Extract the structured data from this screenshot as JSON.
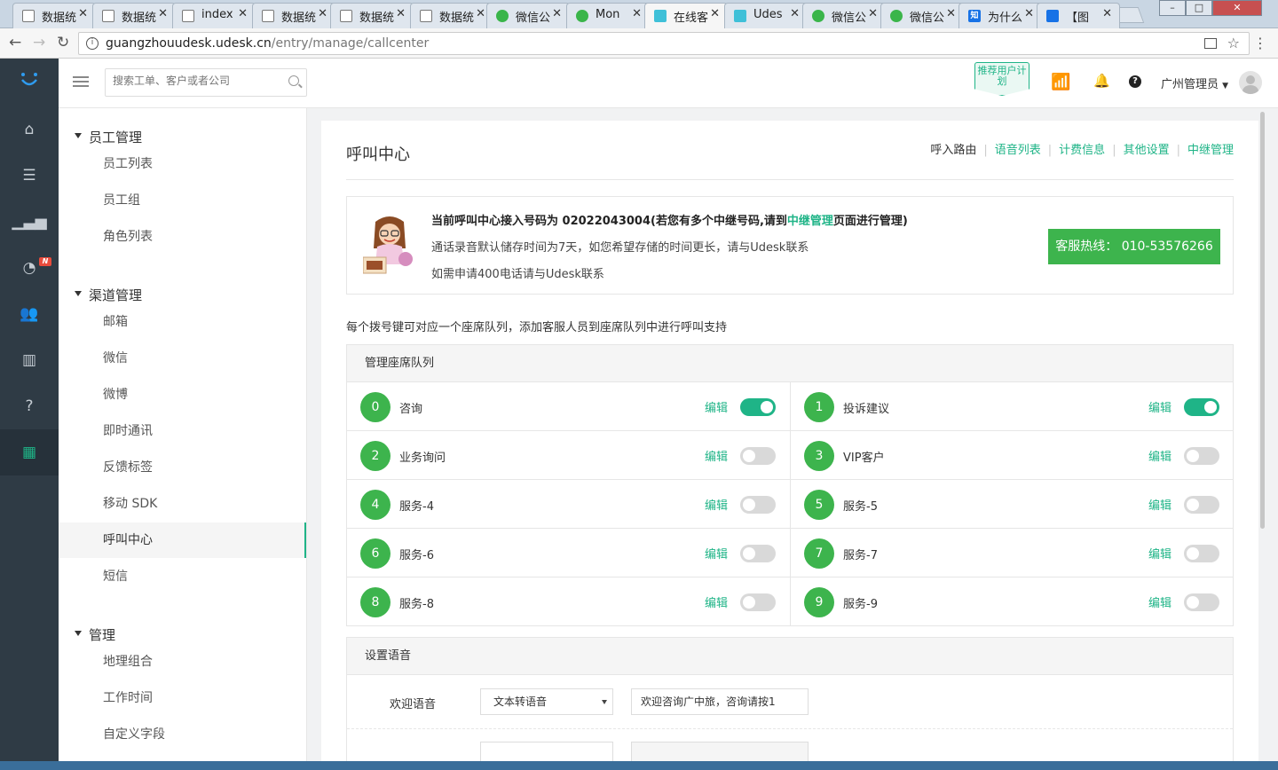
{
  "browser": {
    "tabs": [
      {
        "label": "数据统",
        "icon": "page-icon",
        "active": false
      },
      {
        "label": "数据统",
        "icon": "page-icon",
        "active": false
      },
      {
        "label": "index",
        "icon": "page-icon",
        "active": false
      },
      {
        "label": "数据统",
        "icon": "page-icon",
        "active": false
      },
      {
        "label": "数据统",
        "icon": "page-icon",
        "active": false
      },
      {
        "label": "数据统",
        "icon": "page-icon",
        "active": false
      },
      {
        "label": "微信公",
        "icon": "wechat-icon",
        "active": false
      },
      {
        "label": "Mon",
        "icon": "monitor-icon",
        "active": false
      },
      {
        "label": "在线客",
        "icon": "udesk-icon",
        "active": true
      },
      {
        "label": "Udes",
        "icon": "udesk-icon",
        "active": false
      },
      {
        "label": "微信公",
        "icon": "wechat-icon",
        "active": false
      },
      {
        "label": "微信公",
        "icon": "wechat-icon",
        "active": false
      },
      {
        "label": "为什么",
        "icon": "zhihu-icon",
        "active": false
      },
      {
        "label": "【图",
        "icon": "baidu-icon",
        "active": false
      }
    ],
    "url_host": "guangzhouudesk.udesk.cn",
    "url_path": "/entry/manage/callcenter"
  },
  "topbar": {
    "search_placeholder": "搜索工单、客户或者公司",
    "promo_label": "推荐用户计划",
    "admin_name": "广州管理员"
  },
  "sidebar": {
    "groups": [
      {
        "label": "员工管理",
        "items": [
          "员工列表",
          "员工组",
          "角色列表"
        ]
      },
      {
        "label": "渠道管理",
        "items": [
          "邮箱",
          "微信",
          "微博",
          "即时通讯",
          "反馈标签",
          "移动 SDK",
          "呼叫中心",
          "短信"
        ]
      },
      {
        "label": "管理",
        "items": [
          "地理组合",
          "工作时间",
          "自定义字段"
        ]
      }
    ],
    "active_item": "呼叫中心"
  },
  "page": {
    "title": "呼叫中心",
    "links": [
      "呼入路由",
      "语音列表",
      "计费信息",
      "其他设置",
      "中继管理"
    ],
    "info": {
      "line1_prefix": "当前呼叫中心接入号码为 02022043004(若您有多个中继号码,请到",
      "line1_link": "中继管理",
      "line1_suffix": "页面进行管理)",
      "line2": "通话录音默认储存时间为7天，如您希望存储的时间更长，请与Udesk联系",
      "line3": "如需申请400电话请与Udesk联系",
      "hotline": "客服热线： 010-53576266"
    },
    "note": "每个拨号键可对应一个座席队列，添加客服人员到座席队列中进行呼叫支持",
    "queue_title": "管理座席队列",
    "edit_label": "编辑",
    "queues": [
      {
        "key": "0",
        "name": "咨询",
        "enabled": true
      },
      {
        "key": "1",
        "name": "投诉建议",
        "enabled": true
      },
      {
        "key": "2",
        "name": "业务询问",
        "enabled": false
      },
      {
        "key": "3",
        "name": "VIP客户",
        "enabled": false
      },
      {
        "key": "4",
        "name": "服务-4",
        "enabled": false
      },
      {
        "key": "5",
        "name": "服务-5",
        "enabled": false
      },
      {
        "key": "6",
        "name": "服务-6",
        "enabled": false
      },
      {
        "key": "7",
        "name": "服务-7",
        "enabled": false
      },
      {
        "key": "8",
        "name": "服务-8",
        "enabled": false
      },
      {
        "key": "9",
        "name": "服务-9",
        "enabled": false
      }
    ],
    "voice_title": "设置语音",
    "welcome_label": "欢迎语音",
    "welcome_type": "文本转语音",
    "welcome_text": "欢迎咨询广中旅，咨询请按1"
  },
  "colors": {
    "accent": "#1fb487",
    "button_green": "#3db44d",
    "leftbar": "#2f3b45"
  }
}
